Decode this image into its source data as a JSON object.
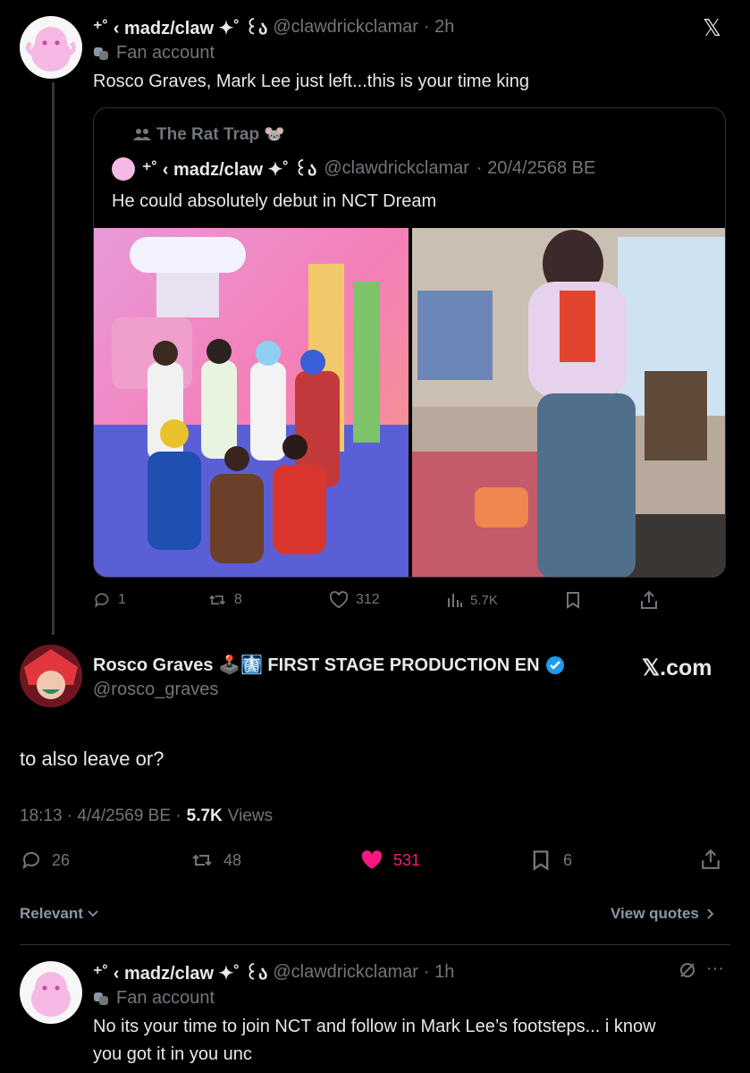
{
  "colors": {
    "background": "#000000",
    "text": "#e7e9ea",
    "muted": "#71767b",
    "like": "#f91880",
    "verified": "#1d9bf0",
    "border": "#2f3336"
  },
  "close_icon_glyph": "𝕏",
  "tweet1": {
    "name": "⁺˚ ‹ madz/claw ✦˚ ꒰ა",
    "handle": "@clawdrickclamar",
    "time": "· 2h",
    "label": "Fan account",
    "text": "Rosco Graves, Mark Lee just left...this is your time king",
    "quote": {
      "community": "The Rat Trap 🐭",
      "name": "⁺˚ ‹ madz/claw ✦˚ ꒰ა",
      "handle": "@clawdrickclamar",
      "date": "· 20/4/2568 BE",
      "text": "He could absolutely debut in NCT Dream"
    },
    "actions": {
      "replies": "1",
      "reposts": "8",
      "likes": "312",
      "views": "5.7K"
    }
  },
  "main": {
    "name": "Rosco Graves 🕹️🩻 FIRST STAGE PRODUCTION EN",
    "handle": "@rosco_graves",
    "watermark": "𝕏.com",
    "text": "to also leave or?",
    "meta_time": "18:13 · 4/4/2569 BE ·",
    "meta_views": "5.7K",
    "meta_views_label": "Views",
    "actions": {
      "replies": "26",
      "reposts": "48",
      "likes": "531",
      "bookmarks": "6"
    },
    "sort_label": "Relevant",
    "view_quotes": "View quotes"
  },
  "reply": {
    "name": "⁺˚ ‹ madz/claw ✦˚ ꒰ა",
    "handle": "@clawdrickclamar",
    "time": "· 1h",
    "label": "Fan account",
    "text_line1": "No its your time to join NCT and follow in Mark Lee’s footsteps... i know",
    "text_line2": "you got it in you unc",
    "more": "···"
  }
}
